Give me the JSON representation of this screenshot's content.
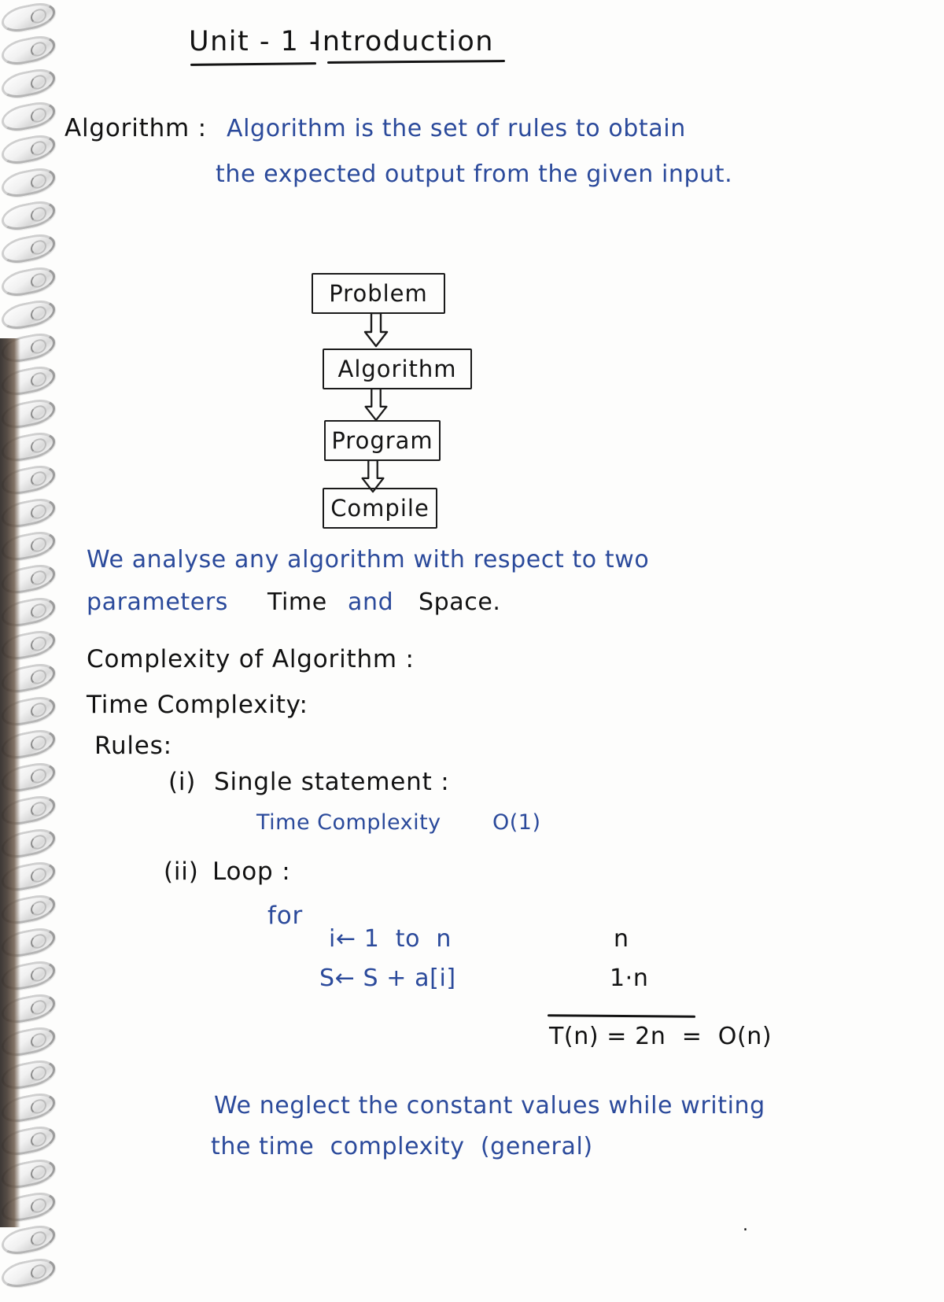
{
  "page": {
    "title": "Unit - 1 - Introduction",
    "title_parts": {
      "left": "Unit - 1 -",
      "right": "Introduction"
    },
    "paper": "spiral-bound ruled notebook page",
    "ink_colors": {
      "black": "#121212",
      "blue": "#2b4a9b"
    }
  },
  "sections": {
    "algorithm": {
      "label": "Algorithm :",
      "definition_line_1": "Algorithm is the set of rules to obtain",
      "definition_line_2": "the expected output from the given input."
    },
    "flowchart": {
      "type": "vertical-flow",
      "nodes": [
        "Problem",
        "Algorithm",
        "Program",
        "Compile"
      ],
      "arrow_glyph": "hollow-down-arrow"
    },
    "analysis": {
      "line_1": "We analyse any algorithm with respect to two",
      "line_2_blue": "parameters",
      "line_2_black_a": "Time",
      "line_2_blue_and": "and",
      "line_2_black_b": "Space."
    },
    "complexity": {
      "heading": "Complexity of Algorithm :",
      "subheading": "Time Complexity:",
      "rules_label": "Rules:",
      "rules": [
        {
          "marker": "(i)",
          "title": "Single statement :",
          "body_label": "Time Complexity",
          "body_value": "O(1)"
        },
        {
          "marker": "(ii)",
          "title": "Loop :",
          "keyword": "for",
          "code_lines": [
            "i← 1  to  n",
            "S← S + a[i]"
          ],
          "cost_column": [
            "n",
            "1·n"
          ],
          "result": "T(n) = 2n  =  O(n)"
        }
      ]
    },
    "note": {
      "line_1": "We neglect the constant values while writing",
      "line_2": "the time  complexity  (general)"
    }
  }
}
